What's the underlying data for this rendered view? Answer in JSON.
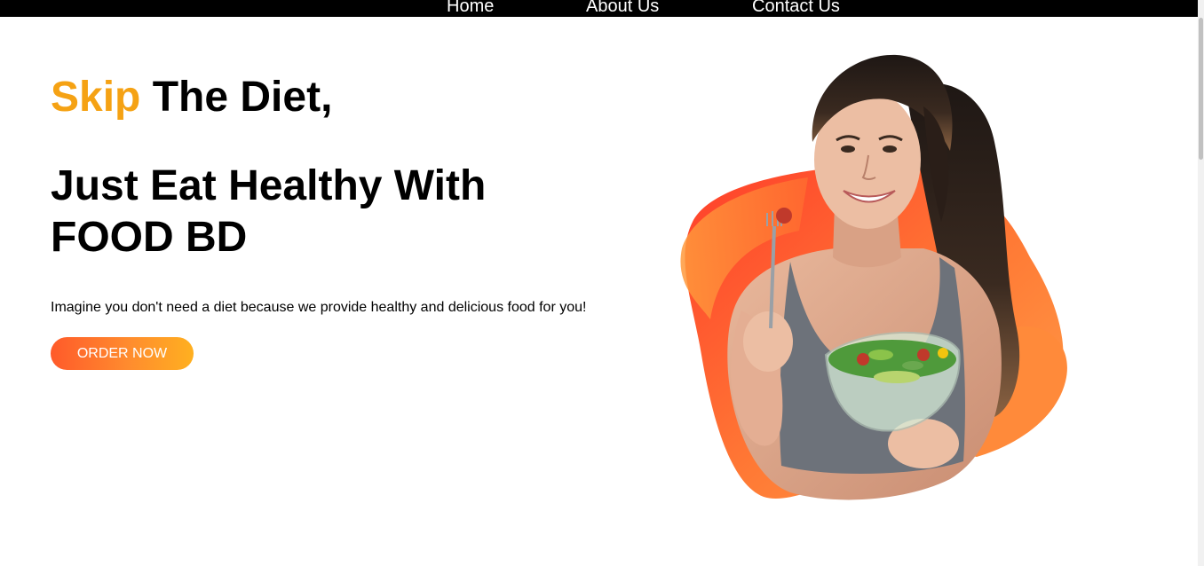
{
  "nav": {
    "items": [
      {
        "label": "Home"
      },
      {
        "label": "About Us"
      },
      {
        "label": "Contact Us"
      }
    ]
  },
  "hero": {
    "title_accent": "Skip",
    "title_rest": " The Diet,",
    "title_line2": "Just Eat Healthy With FOOD BD",
    "subtitle": "Imagine you don't need a diet because we provide healthy and delicious food for you!",
    "cta_label": "ORDER NOW"
  },
  "colors": {
    "accent": "#f5a214",
    "nav_bg": "#000000",
    "button_gradient_start": "#ff5a2a",
    "button_gradient_end": "#ffb020"
  },
  "image": {
    "icon": "woman-eating-salad-illustration"
  }
}
